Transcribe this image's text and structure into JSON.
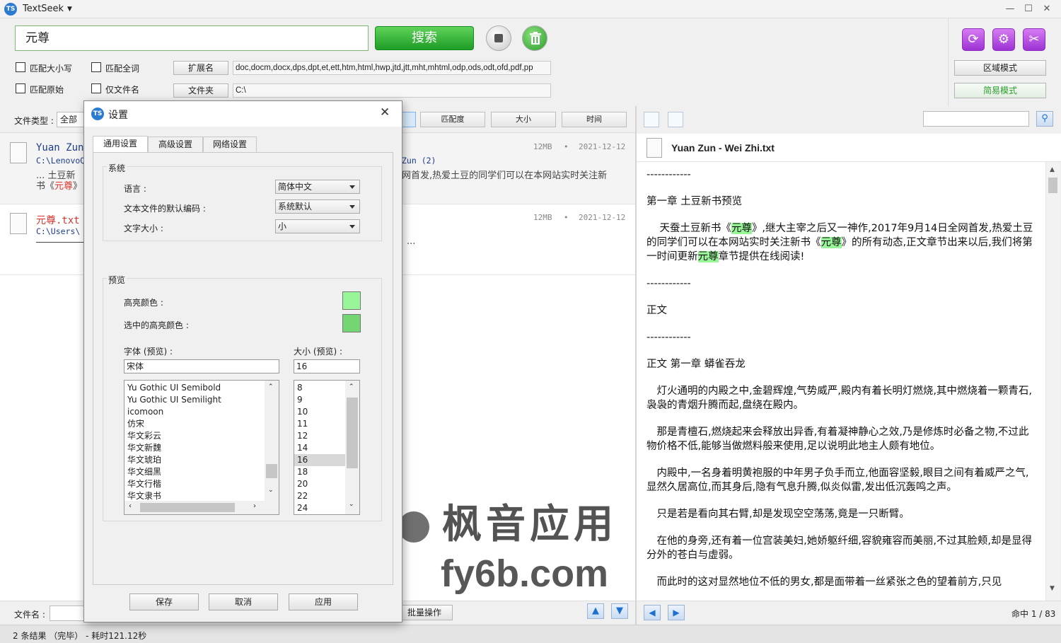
{
  "app": {
    "title": "TextSeek",
    "logo": "TS"
  },
  "search": {
    "query": "元尊",
    "search_label": "搜索"
  },
  "options": {
    "match_case": "匹配大小写",
    "match_whole_word": "匹配全词",
    "match_original": "匹配原始",
    "filename_only": "仅文件名"
  },
  "filters": {
    "extension_label": "扩展名",
    "extension_value": "doc,docm,docx,dps,dpt,et,ett,htm,html,hwp,jtd,jtt,mht,mhtml,odp,ods,odt,ofd,pdf,pp",
    "folder_label": "文件夹",
    "folder_value": "C:\\"
  },
  "modes": {
    "area_mode": "区域模式",
    "simple_mode": "简易模式"
  },
  "list_header": {
    "file_type_label": "文件类型 :",
    "file_type_value": "全部",
    "match_degree": "匹配度",
    "size": "大小",
    "time": "时间"
  },
  "results": [
    {
      "title": "Yuan Zun",
      "path": "C:\\LenovoQ",
      "extra": "Zun (2)",
      "size": "12MB",
      "date": "2021-12-12",
      "snippet_a": "... 土豆新",
      "snippet_b": "网首发,热爱土豆的同学们可以在本网站实时关注新",
      "snippet_c_pre": "书《",
      "snippet_c_hl": "元尊",
      "snippet_c_post": "》"
    },
    {
      "title": "元尊.txt",
      "path": "C:\\Users\\",
      "size": "12MB",
      "date": "2021-12-12",
      "snippet_tail": "..."
    }
  ],
  "bottom_left": {
    "filename_label": "文件名 :",
    "batch_label": "批量操作"
  },
  "status": {
    "text": "2 条结果  （完毕）  -  耗时121.12秒"
  },
  "preview": {
    "filename": "Yuan Zun - Wei Zhi.txt",
    "hit_counter": "命中 1 / 83",
    "sep1": "------------",
    "chapter1": "第一章 土豆新书预览",
    "p1_a": "天蚕土豆新书《",
    "p1_hl1": "元尊",
    "p1_b": "》,继大主宰之后又一神作,2017年9月14日全网首发,热爱土豆的同学们可以在本网站实时关注新书《",
    "p1_hl2": "元尊",
    "p1_c": "》的所有动态,正文章节出来以后,我们将第一时间更新",
    "p1_hl3": "元尊",
    "p1_d": "章节提供在线阅读!",
    "sep2": "------------",
    "zhengwen": "正文",
    "sep3": "------------",
    "chapter2": "正文 第一章 蟒雀吞龙",
    "p2": "灯火通明的内殿之中,金碧辉煌,气势威严,殿内有着长明灯燃烧,其中燃烧着一颗青石,袅袅的青烟升腾而起,盘绕在殿内。",
    "p3": "那是青檀石,燃烧起来会释放出异香,有着凝神静心之效,乃是修炼时必备之物,不过此物价格不低,能够当做燃料般来使用,足以说明此地主人颇有地位。",
    "p4": "内殿中,一名身着明黄袍服的中年男子负手而立,他面容坚毅,眼目之间有着威严之气,显然久居高位,而其身后,隐有气息升腾,似炎似雷,发出低沉轰鸣之声。",
    "p5": "只是若是看向其右臂,却是发现空空荡荡,竟是一只断臂。",
    "p6": "在他的身旁,还有着一位宫装美妇,她娇躯纤细,容貌雍容而美丽,不过其脸颊,却是显得分外的苍白与虚弱。",
    "p7": "而此时的这对显然地位不低的男女,都是面带着一丝紧张之色的望着前方,只见"
  },
  "dialog": {
    "title": "设置",
    "tabs": [
      "通用设置",
      "高级设置",
      "网络设置"
    ],
    "system_group": "系统",
    "language_label": "语言 :",
    "language_value": "简体中文",
    "encoding_label": "文本文件的默认编码 :",
    "encoding_value": "系统默认",
    "textsize_label": "文字大小 :",
    "textsize_value": "小",
    "preview_group": "预览",
    "highlight_label": "高亮颜色 :",
    "selected_highlight_label": "选中的高亮颜色 :",
    "highlight_color": "#98f598",
    "selected_highlight_color": "#73d673",
    "font_label": "字体 (预览) :",
    "font_value": "宋体",
    "size_label": "大小 (预览) :",
    "size_value": "16",
    "font_list": [
      "Yu Gothic UI Semibold",
      "Yu Gothic UI Semilight",
      "icomoon",
      "仿宋",
      "华文彩云",
      "华文新魏",
      "华文琥珀",
      "华文细黑",
      "华文行楷",
      "华文隶书"
    ],
    "size_list": [
      "8",
      "9",
      "10",
      "11",
      "12",
      "14",
      "16",
      "18",
      "20",
      "22",
      "24"
    ],
    "save": "保存",
    "cancel": "取消",
    "apply": "应用"
  },
  "watermark": {
    "cn": "枫音应用",
    "url": "fy6b.com"
  },
  "colors": {
    "search_green": "#1e9c25",
    "highlight": "#98f598",
    "hit_red": "#d9332b",
    "tool_purple": "#9c32d4"
  }
}
